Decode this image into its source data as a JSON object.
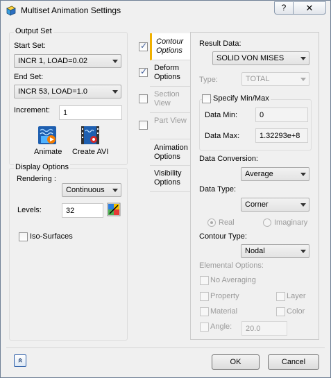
{
  "window": {
    "title": "Multiset Animation Settings",
    "help_label": "?",
    "close_label": "✕"
  },
  "output_set": {
    "group_label": "Output Set",
    "start_label": "Start Set:",
    "start_value": "INCR 1, LOAD=0.02",
    "end_label": "End Set:",
    "end_value": "INCR 53, LOAD=1.0",
    "increment_label": "Increment:",
    "increment_value": "1",
    "animate_label": "Animate",
    "create_avi_label": "Create AVI"
  },
  "display_options": {
    "group_label": "Display Options",
    "rendering_label": "Rendering :",
    "rendering_value": "Continuous",
    "levels_label": "Levels:",
    "levels_value": "32",
    "iso_surfaces_label": "Iso-Surfaces",
    "iso_surfaces_checked": false
  },
  "tabs": [
    {
      "label": "Contour Options",
      "checked": true,
      "active": true
    },
    {
      "label": "Deform Options",
      "checked": true,
      "active": false
    },
    {
      "label": "Section View",
      "checked": false,
      "active": false
    },
    {
      "label": "Part View",
      "checked": false,
      "active": false
    },
    {
      "label": "Animation Options",
      "active": false
    },
    {
      "label": "Visibility Options",
      "active": false
    }
  ],
  "contour": {
    "result_data_label": "Result Data:",
    "result_data_value": "SOLID VON MISES",
    "type_label": "Type:",
    "type_value": "TOTAL",
    "specify_minmax_label": "Specify Min/Max",
    "specify_minmax_checked": false,
    "data_min_label": "Data Min:",
    "data_min_value": "0",
    "data_max_label": "Data Max:",
    "data_max_value": "1.32293e+8",
    "data_conversion_label": "Data Conversion:",
    "data_conversion_value": "Average",
    "data_type_label": "Data Type:",
    "data_type_value": "Corner",
    "real_label": "Real",
    "imaginary_label": "Imaginary",
    "contour_type_label": "Contour Type:",
    "contour_type_value": "Nodal",
    "elemental_options_label": "Elemental Options:",
    "no_averaging_label": "No Averaging",
    "property_label": "Property",
    "layer_label": "Layer",
    "material_label": "Material",
    "color_label": "Color",
    "angle_label": "Angle:",
    "angle_value": "20.0"
  },
  "footer": {
    "ok_label": "OK",
    "cancel_label": "Cancel",
    "collapse_label": "«"
  }
}
